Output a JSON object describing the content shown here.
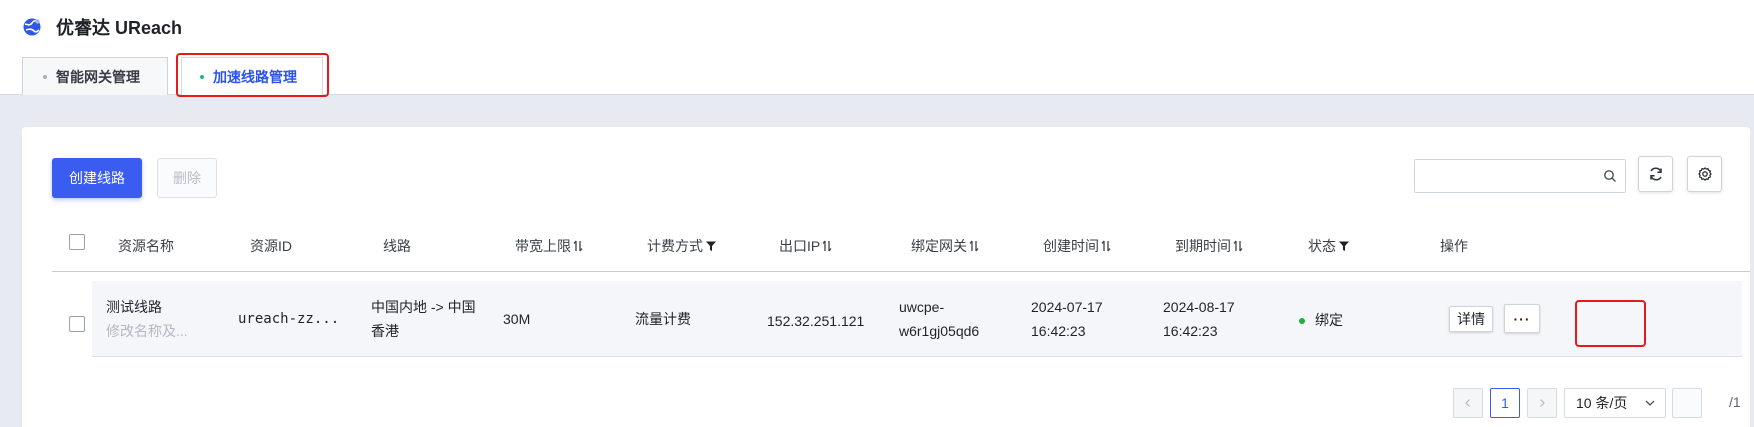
{
  "app": {
    "title": "优睿达 UReach"
  },
  "tabs": [
    {
      "label": "智能网关管理",
      "active": false
    },
    {
      "label": "加速线路管理",
      "active": true
    }
  ],
  "toolbar": {
    "create_label": "创建线路",
    "delete_label": "删除"
  },
  "search": {
    "placeholder": "",
    "value": ""
  },
  "table": {
    "columns": [
      "资源名称",
      "资源ID",
      "线路",
      "带宽上限",
      "计费方式",
      "出口IP",
      "绑定网关",
      "创建时间",
      "到期时间",
      "状态",
      "操作"
    ],
    "rows": [
      {
        "name": "测试线路",
        "name_hint": "修改名称及...",
        "id": "ureach-zz...",
        "route_line1": "中国内地 -> 中国",
        "route_line2": "香港",
        "bandwidth": "30M",
        "billing": "流量计费",
        "ip": "152.32.251.121",
        "gateway_line1": "uwcpe-",
        "gateway_line2": "w6r1gj05qd6",
        "created_date": "2024-07-17",
        "created_time": "16:42:23",
        "expire_date": "2024-08-17",
        "expire_time": "16:42:23",
        "status": "绑定",
        "detail_label": "详情",
        "more_label": "···"
      }
    ]
  },
  "pagination": {
    "current_page": "1",
    "page_size_label": "10 条/页",
    "total_label": "/1"
  },
  "colors": {
    "primary": "#3a5cf0",
    "highlight": "#e81919",
    "status_bound": "#1db03b",
    "active_tab_dot": "#17b897"
  }
}
